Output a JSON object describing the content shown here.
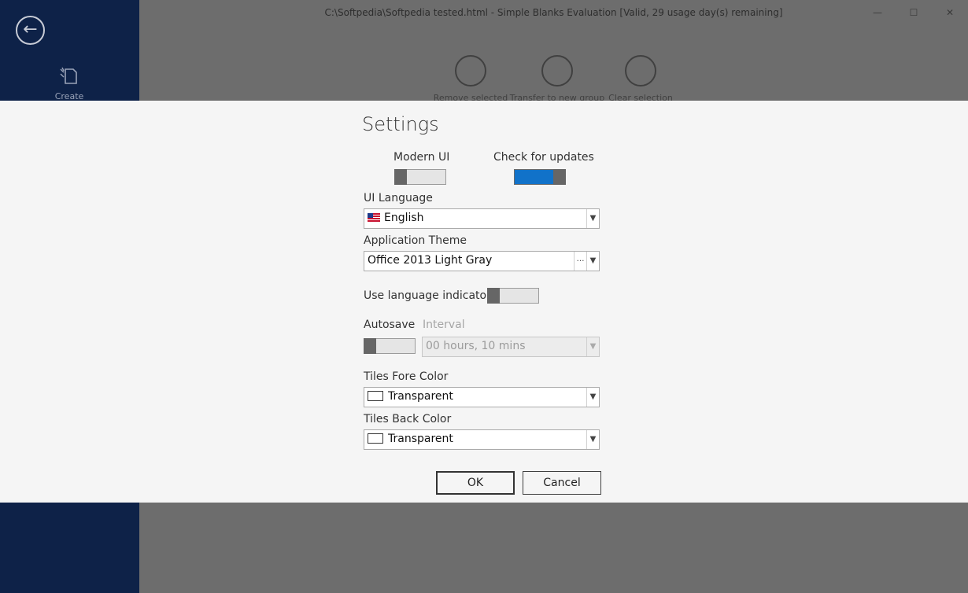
{
  "window": {
    "title": "C:\\Softpedia\\Softpedia tested.html - Simple Blanks Evaluation [Valid, 29 usage day(s) remaining]",
    "minimize": "—",
    "maximize": "☐",
    "close": "✕"
  },
  "sidebar": {
    "back_icon": "←",
    "create_label": "Create"
  },
  "toolbar": {
    "remove_selected": "Remove selected",
    "transfer_to_new_group": "Transfer to new group",
    "clear_selection": "Clear selection"
  },
  "settings": {
    "title": "Settings",
    "modern_ui_label": "Modern UI",
    "modern_ui_on": false,
    "check_updates_label": "Check for updates",
    "check_updates_on": true,
    "ui_language_label": "UI Language",
    "ui_language_value": "English",
    "app_theme_label": "Application Theme",
    "app_theme_value": "Office 2013 Light Gray",
    "lang_indicator_label": "Use language indicator",
    "lang_indicator_on": false,
    "autosave_label": "Autosave",
    "autosave_on": false,
    "interval_label": "Interval",
    "interval_value": "00 hours, 10 mins",
    "tiles_fore_label": "Tiles Fore Color",
    "tiles_fore_value": "Transparent",
    "tiles_back_label": "Tiles Back Color",
    "tiles_back_value": "Transparent",
    "ok_label": "OK",
    "cancel_label": "Cancel"
  }
}
